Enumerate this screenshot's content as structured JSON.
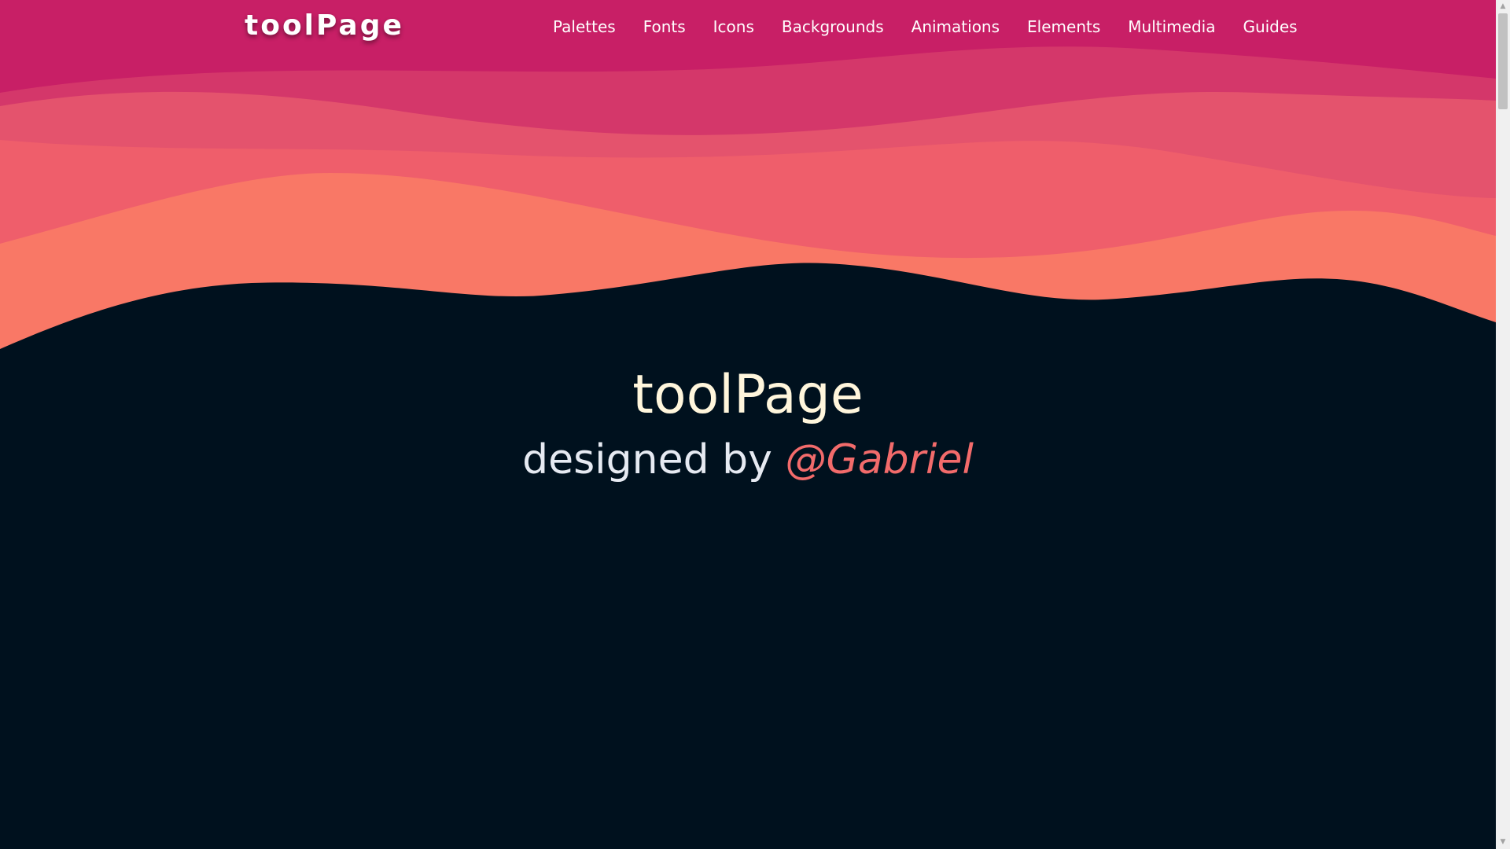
{
  "brand": {
    "logo": "toolPage"
  },
  "nav": {
    "items": [
      {
        "label": "Palettes"
      },
      {
        "label": "Fonts"
      },
      {
        "label": "Icons"
      },
      {
        "label": "Backgrounds"
      },
      {
        "label": "Animations"
      },
      {
        "label": "Elements"
      },
      {
        "label": "Multimedia"
      },
      {
        "label": "Guides"
      }
    ]
  },
  "hero": {
    "title": "toolPage",
    "subtitle_prefix": "designed by",
    "author": "@Gabriel"
  },
  "colors": {
    "wave_top": "#c81f66",
    "wave_2": "#d4376a",
    "wave_3": "#e4536d",
    "wave_4": "#ef5e6b",
    "wave_5": "#f97866",
    "background": "#00111e",
    "title": "#fff6dc",
    "accent": "#f26b6b"
  },
  "scrollbar": {
    "up_icon": "chevron-up-icon",
    "down_icon": "chevron-down-icon"
  }
}
